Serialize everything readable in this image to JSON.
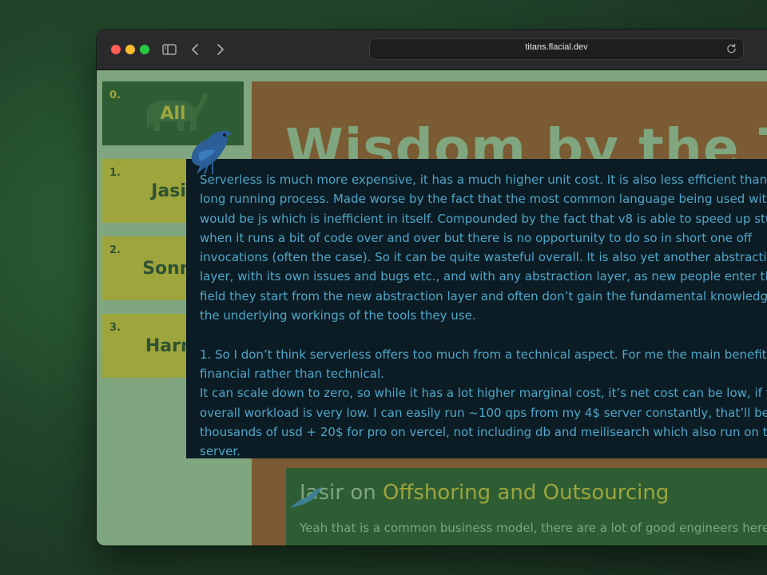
{
  "browser": {
    "url": "titans.flacial.dev"
  },
  "sidebar": {
    "cards": [
      {
        "number": "0.",
        "name": "All"
      },
      {
        "number": "1.",
        "name": "Jasir"
      },
      {
        "number": "2.",
        "name": "Sonny"
      },
      {
        "number": "3.",
        "name": "Harry"
      }
    ]
  },
  "main": {
    "title": "Wisdom by the Titans"
  },
  "tooltip": {
    "text": "Serverless is much more expensive, it has a much higher unit cost. It is also less efficient than a long running process. Made worse by the fact that the most common language being used with it would be js which is inefficient in itself. Compounded by the fact that v8 is able to speed up stuff when it runs a bit of code over and over but there is no opportunity to do so in short one off invocations (often the case). So it can be quite wasteful overall. It is also yet another abstraction layer, with its own issues and bugs etc., and with any abstraction layer, as new people enter the field they start from the new abstraction layer and often don’t gain the fundamental knowledge of the underlying workings of the tools they use.\n\n1. So I don’t think serverless offers too much from a technical aspect. For me the main benefit is financial rather than technical.\nIt can scale down to zero, so while it has a lot higher marginal cost, it’s net cost can be low, if your overall workload is very low. I can easily run ~100 qps from my 4$ server constantly, that’ll be thousands of usd + 20$ for pro on vercel, not including db and meilisearch which also run on that server."
  },
  "post": {
    "author": "Jasir",
    "connector": "on",
    "topic": "Offshoring and Outsourcing",
    "preview": "Yeah that is a common business model, there are a lot of good engineers here that"
  },
  "colors": {
    "page_bg": "#7fa67e",
    "card_dark": "#2e5d34",
    "card_olive": "#9da53c",
    "panel_brown": "#7a5b33",
    "tooltip_bg": "#0c1c24",
    "tooltip_text": "#4fa6c9"
  }
}
